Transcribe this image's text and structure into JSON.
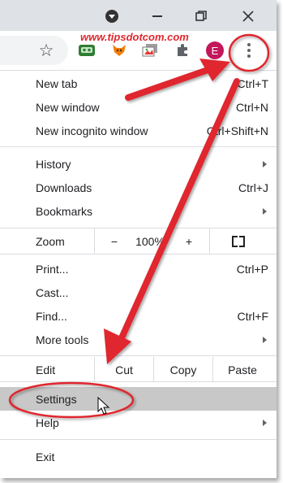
{
  "watermark": "www.tipsdotcom.com",
  "toolbar": {
    "avatar_letter": "E",
    "icons": [
      "star-icon",
      "robot-extension-icon",
      "fox-extension-icon",
      "stack-extension-icon",
      "puzzle-icon",
      "avatar",
      "more-menu-icon"
    ]
  },
  "menu": {
    "new_tab": {
      "label": "New tab",
      "shortcut": "Ctrl+T"
    },
    "new_window": {
      "label": "New window",
      "shortcut": "Ctrl+N"
    },
    "new_incognito": {
      "label": "New incognito window",
      "shortcut": "Ctrl+Shift+N"
    },
    "history": {
      "label": "History"
    },
    "downloads": {
      "label": "Downloads",
      "shortcut": "Ctrl+J"
    },
    "bookmarks": {
      "label": "Bookmarks"
    },
    "zoom": {
      "label": "Zoom",
      "minus": "−",
      "value": "100%",
      "plus": "+"
    },
    "print": {
      "label": "Print...",
      "shortcut": "Ctrl+P"
    },
    "cast": {
      "label": "Cast..."
    },
    "find": {
      "label": "Find...",
      "shortcut": "Ctrl+F"
    },
    "more_tools": {
      "label": "More tools"
    },
    "edit": {
      "label": "Edit",
      "cut": "Cut",
      "copy": "Copy",
      "paste": "Paste"
    },
    "settings": {
      "label": "Settings"
    },
    "help": {
      "label": "Help"
    },
    "exit": {
      "label": "Exit"
    }
  },
  "colors": {
    "annotation": "#e0282e",
    "highlight": "#c8c8c8"
  }
}
